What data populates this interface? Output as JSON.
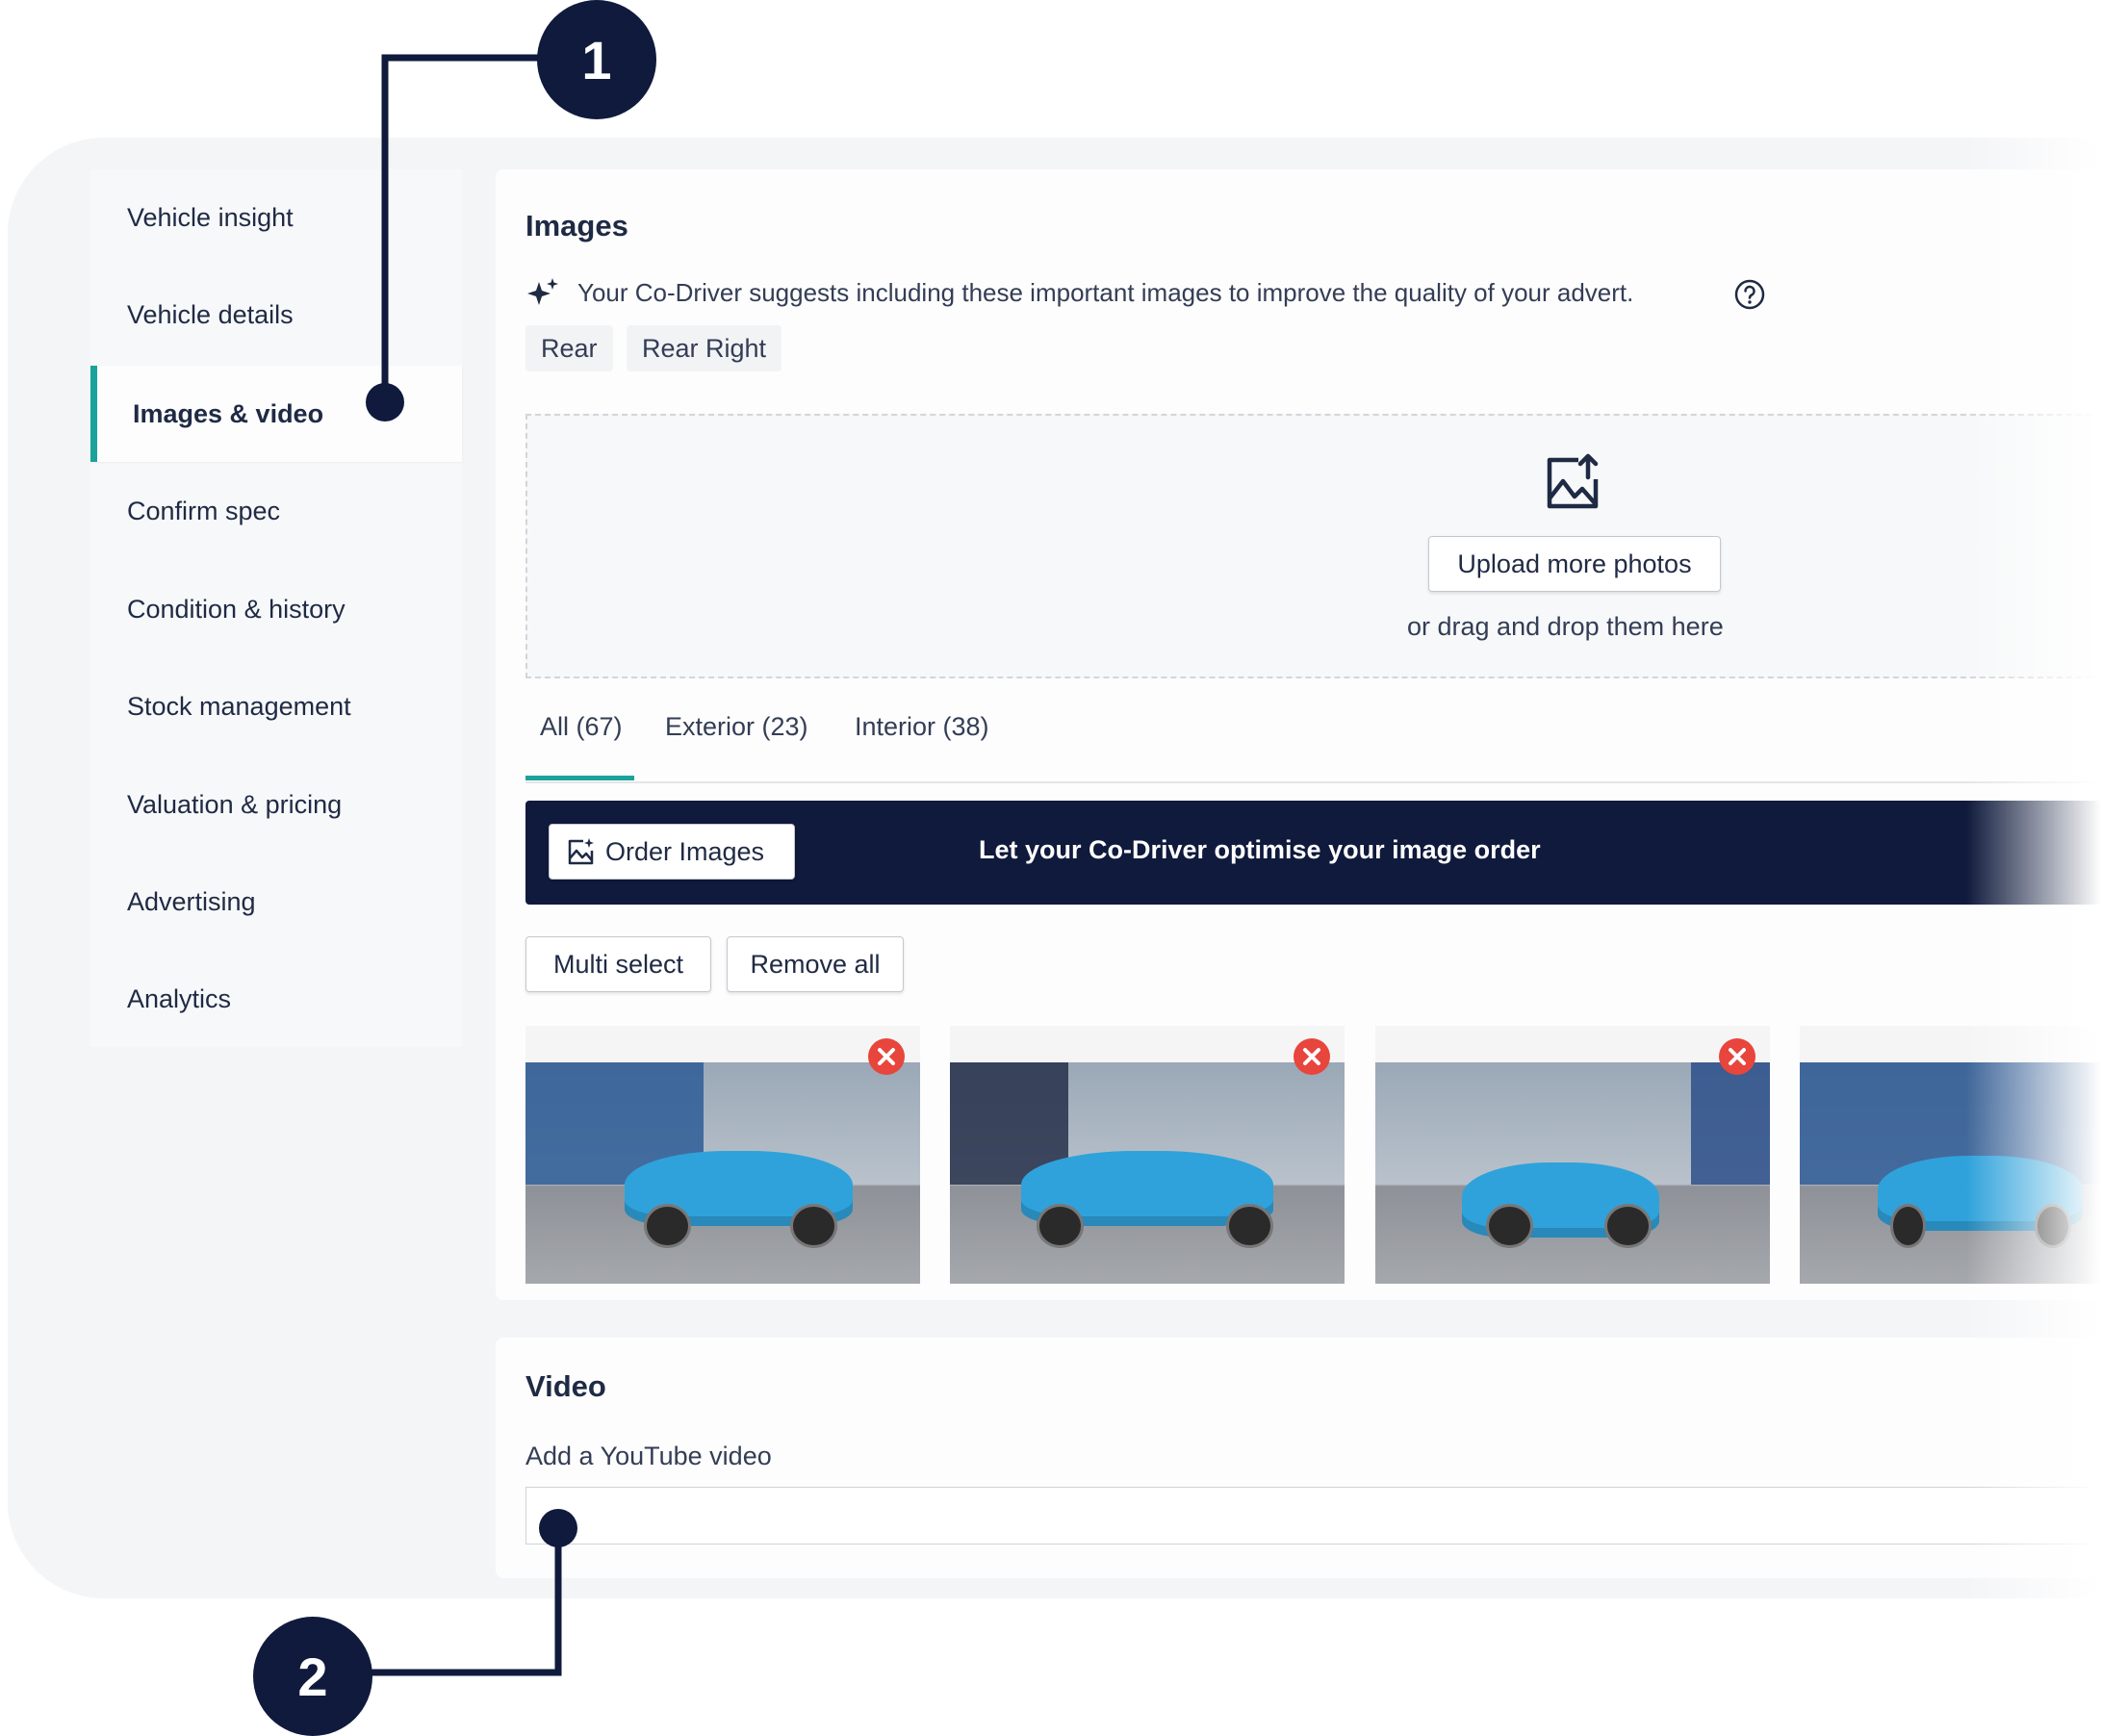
{
  "sidebar": {
    "items": [
      {
        "label": "Vehicle insight",
        "active": false
      },
      {
        "label": "Vehicle details",
        "active": false
      },
      {
        "label": "Images & video",
        "active": true
      },
      {
        "label": "Confirm spec",
        "active": false
      },
      {
        "label": "Condition & history",
        "active": false
      },
      {
        "label": "Stock management",
        "active": false
      },
      {
        "label": "Valuation & pricing",
        "active": false
      },
      {
        "label": "Advertising",
        "active": false
      },
      {
        "label": "Analytics",
        "active": false
      }
    ]
  },
  "images": {
    "title": "Images",
    "suggestion_text": "Your Co-Driver suggests including these important images to improve the quality of your advert.",
    "suggested_chips": [
      "Rear",
      "Rear Right"
    ],
    "upload_button": "Upload more photos",
    "drop_hint": "or drag and drop them here",
    "tabs": [
      {
        "label": "All (67)",
        "active": true
      },
      {
        "label": "Exterior (23)",
        "active": false
      },
      {
        "label": "Interior (38)",
        "active": false
      }
    ],
    "order_button": "Order Images",
    "banner_text": "Let your Co-Driver optimise your image order",
    "multi_select_button": "Multi select",
    "remove_all_button": "Remove all"
  },
  "video": {
    "title": "Video",
    "youtube_label": "Add a YouTube video",
    "youtube_value": ""
  },
  "callouts": [
    "1",
    "2"
  ],
  "colors": {
    "accent": "#1aa39a",
    "navy": "#0f1a3c",
    "remove_red": "#e8453c",
    "car_blue": "#2fa2db"
  },
  "icons": [
    "sparkle-icon",
    "help-circle-icon",
    "image-upload-icon",
    "image-sparkle-icon",
    "close-circle-icon"
  ]
}
